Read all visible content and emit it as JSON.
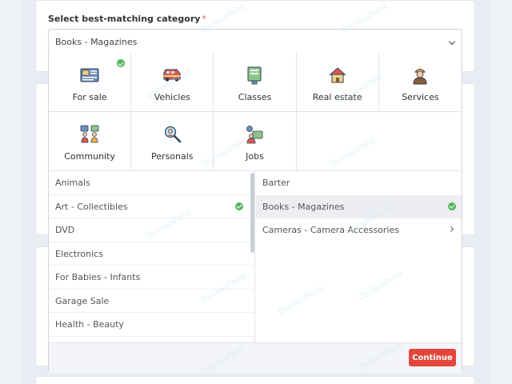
{
  "form": {
    "label": "Select best-matching category",
    "required_mark": "*",
    "selected_value": "Books - Magazines"
  },
  "categories": [
    {
      "label": "For sale",
      "icon": "newspaper-icon",
      "checked": true
    },
    {
      "label": "Vehicles",
      "icon": "van-icon",
      "checked": false
    },
    {
      "label": "Classes",
      "icon": "book-icon",
      "checked": false
    },
    {
      "label": "Real estate",
      "icon": "house-icon",
      "checked": false
    },
    {
      "label": "Services",
      "icon": "worker-icon",
      "checked": false
    },
    {
      "label": "Community",
      "icon": "people-icon",
      "checked": false
    },
    {
      "label": "Personals",
      "icon": "person-search-icon",
      "checked": false
    },
    {
      "label": "Jobs",
      "icon": "job-icon",
      "checked": false
    }
  ],
  "left_list": [
    {
      "label": "Animals",
      "checked": false
    },
    {
      "label": "Art - Collectibles",
      "checked": true
    },
    {
      "label": "DVD",
      "checked": false
    },
    {
      "label": "Electronics",
      "checked": false
    },
    {
      "label": "For Babies - Infants",
      "checked": false
    },
    {
      "label": "Garage Sale",
      "checked": false
    },
    {
      "label": "Health - Beauty",
      "checked": false
    }
  ],
  "right_list": [
    {
      "label": "Barter",
      "selected": false,
      "checked": false,
      "has_children": false
    },
    {
      "label": "Books - Magazines",
      "selected": true,
      "checked": true,
      "has_children": false
    },
    {
      "label": "Cameras - Camera Accessories",
      "selected": false,
      "checked": false,
      "has_children": true
    }
  ],
  "footer": {
    "continue_label": "Continue"
  },
  "watermark": "OsclassPoint",
  "colors": {
    "check": "#52b75c",
    "continue": "#e2463b",
    "selected_row": "#eceef2"
  }
}
